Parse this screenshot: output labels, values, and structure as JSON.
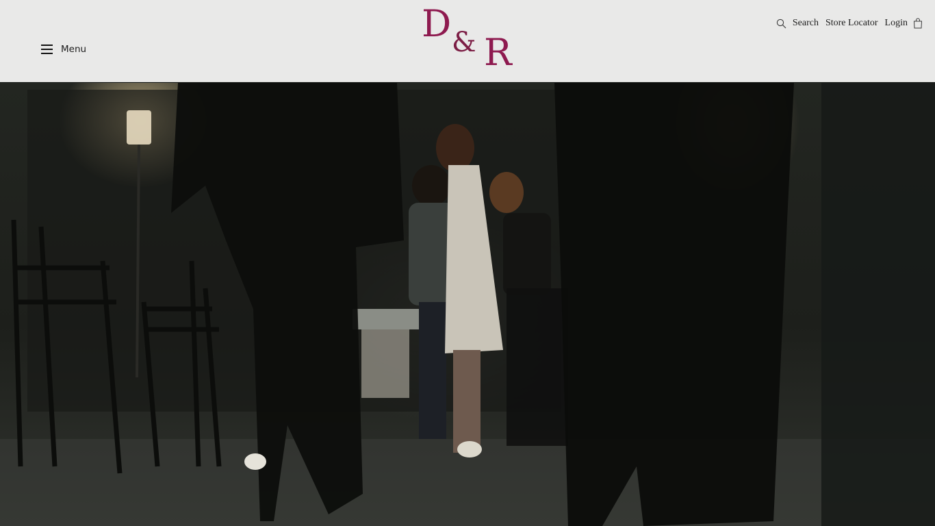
{
  "header": {
    "menu_label": "Menu",
    "logo": {
      "letter_1": "D",
      "ampersand": "&",
      "letter_2": "R"
    },
    "nav": {
      "search_label": "Search",
      "store_locator_label": "Store Locator",
      "login_label": "Login"
    }
  },
  "icons": {
    "menu": "hamburger-icon",
    "search": "search-icon",
    "bag": "shopping-bag-icon"
  },
  "colors": {
    "brand": "#8e1a4f",
    "header_bg": "#e9e9e8",
    "text": "#1c1c1c"
  }
}
